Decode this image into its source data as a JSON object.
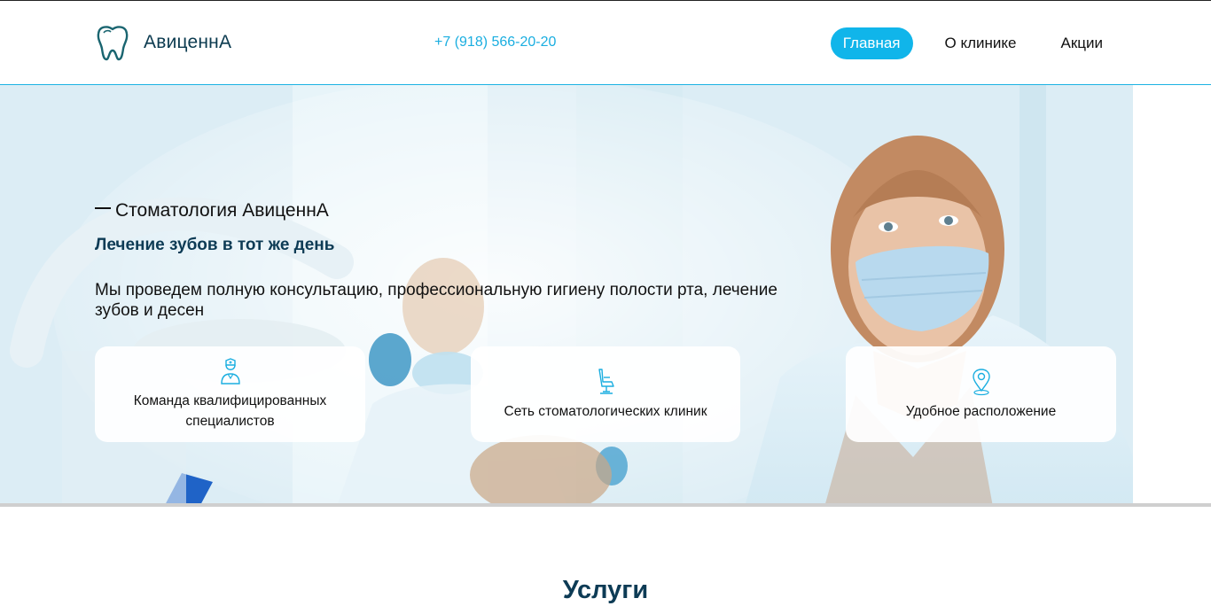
{
  "header": {
    "logo_text": "АвиценнА",
    "phone": "+7 (918) 566-20-20",
    "nav": [
      {
        "label": "Главная",
        "active": true
      },
      {
        "label": "О клинике",
        "active": false
      },
      {
        "label": "Акции",
        "active": false
      }
    ]
  },
  "hero": {
    "subtitle": "Стоматология АвиценнА",
    "title": "Лечение зубов в тот же день",
    "text": "Мы проведем полную консультацию, профессиональную гигиену полости рта, лечение зубов и десен",
    "cards": [
      {
        "icon": "doctor-icon",
        "label": "Команда квалифицированных специалистов"
      },
      {
        "icon": "dental-chair-icon",
        "label": "Сеть стоматологических клиник"
      },
      {
        "icon": "map-pin-icon",
        "label": "Удобное расположение"
      }
    ]
  },
  "services": {
    "title": "Услуги"
  },
  "colors": {
    "accent": "#10b5ea",
    "brand_dark": "#0d3b55",
    "logo": "#0b3a4f"
  }
}
